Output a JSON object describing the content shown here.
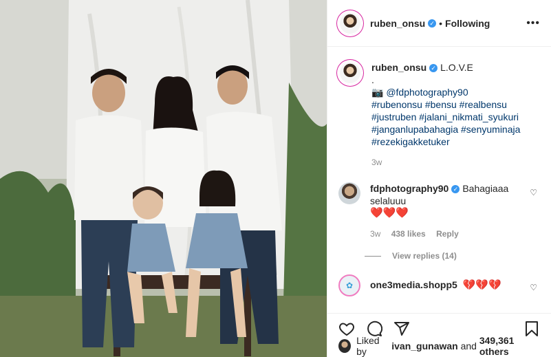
{
  "header": {
    "username": "ruben_onsu",
    "verified_icon": "verified-icon",
    "separator": "•",
    "follow_status": "Following"
  },
  "caption": {
    "username": "ruben_onsu",
    "text": "L.O.V.E",
    "dot_line": ".",
    "camera_emoji": "📷",
    "credit": "@fdphotography90",
    "hashtags": [
      "#rubenonsu #bensu #realbensu",
      "#justruben #jalani_nikmati_syukuri",
      "#janganlupabahagia #senyuminaja",
      "#rezekigakketuker"
    ],
    "time": "3w"
  },
  "comments": [
    {
      "username": "fdphotography90",
      "text": "Bahagiaaa selaluuu",
      "emoji": "❤️❤️❤️",
      "time": "3w",
      "likes": "438 likes",
      "reply_label": "Reply",
      "view_replies": "View replies (14)"
    },
    {
      "username": "one3media.shopp5",
      "emoji": "💔💔💔"
    }
  ],
  "likes": {
    "prefix": "Liked by",
    "user": "ivan_gunawan",
    "suffix": "and",
    "count": "349,361 others"
  },
  "icons": {
    "like": "heart-icon",
    "comment": "comment-icon",
    "share": "share-icon",
    "save": "bookmark-icon"
  },
  "colors": {
    "accent": "#3897f0",
    "hashtag": "#00376b",
    "muted": "#8e8e8e"
  }
}
